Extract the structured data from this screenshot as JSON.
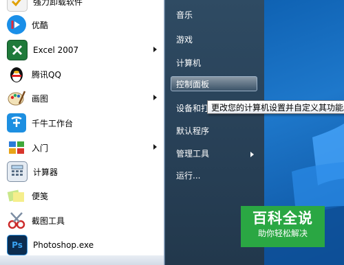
{
  "program_list": [
    {
      "label": "强力卸载软件",
      "icon": "uninstall-icon",
      "has_submenu": false
    },
    {
      "label": "优酷",
      "icon": "youku-icon",
      "has_submenu": false
    },
    {
      "label": "Excel 2007",
      "icon": "excel-icon",
      "has_submenu": true
    },
    {
      "label": "腾讯QQ",
      "icon": "qq-penguin-icon",
      "has_submenu": false
    },
    {
      "label": "画图",
      "icon": "paint-palette-icon",
      "has_submenu": true
    },
    {
      "label": "千牛工作台",
      "icon": "qianniu-icon",
      "has_submenu": false
    },
    {
      "label": "入门",
      "icon": "getting-started-icon",
      "has_submenu": true
    },
    {
      "label": "计算器",
      "icon": "calculator-icon",
      "has_submenu": false
    },
    {
      "label": "便笺",
      "icon": "sticky-notes-icon",
      "has_submenu": false
    },
    {
      "label": "截图工具",
      "icon": "snipping-tool-icon",
      "has_submenu": false
    },
    {
      "label": "Photoshop.exe",
      "icon": "photoshop-icon",
      "has_submenu": false
    }
  ],
  "right_menu": {
    "music": "音乐",
    "games": "游戏",
    "computer": "计算机",
    "control_panel": "控制面板",
    "devices_printers": "设备和打",
    "default_programs": "默认程序",
    "admin_tools": "管理工具",
    "run": "运行..."
  },
  "tooltip": "更改您的计算机设置并自定义其功能。",
  "watermark": {
    "title": "百科全说",
    "subtitle": "助你轻松解决"
  },
  "colors": {
    "watermark_green": "#2aa743",
    "menu_dark": "#294259",
    "desktop_blue": "#1e78cb"
  }
}
